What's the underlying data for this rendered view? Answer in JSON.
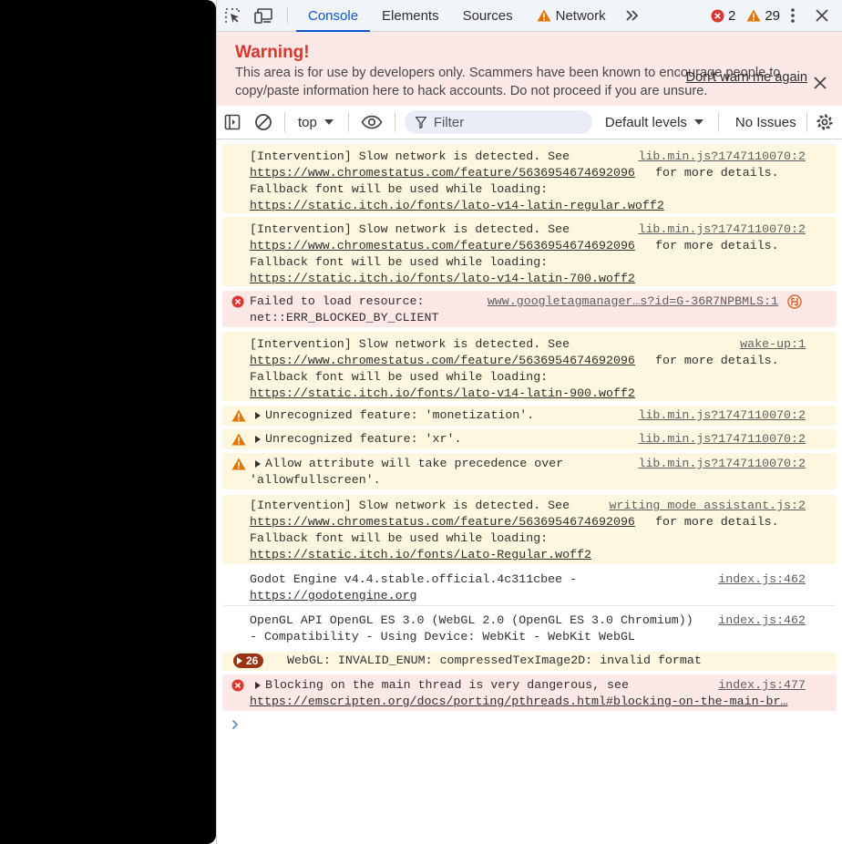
{
  "tabs": {
    "console": "Console",
    "elements": "Elements",
    "sources": "Sources",
    "network": "Network"
  },
  "counters": {
    "errors": "2",
    "warnings": "29"
  },
  "warning": {
    "title": "Warning!",
    "text": "This area is for use by developers only. Scammers have been known to encourage people to copy/paste information here to hack accounts. Do not proceed if you are unsure.",
    "dont_warn": "Don't warn me again"
  },
  "toolbar": {
    "context": "top",
    "filter_placeholder": "Filter",
    "levels": "Default levels",
    "issues": "No Issues"
  },
  "messages": [
    {
      "type": "warning",
      "lines": [
        "[Intervention] Slow network is detected. See",
        "https://www.chromestatus.com/feature/5636954674692096",
        " for more details.",
        "Fallback font will be used while loading:",
        "https://static.itch.io/fonts/lato-v14-latin-regular.woff2"
      ],
      "source": "lib.min.js?1747110070:2"
    },
    {
      "type": "warning",
      "lines": [
        "[Intervention] Slow network is detected. See",
        "https://www.chromestatus.com/feature/5636954674692096",
        " for more details.",
        "Fallback font will be used while loading:",
        "https://static.itch.io/fonts/lato-v14-latin-700.woff2"
      ],
      "source": "lib.min.js?1747110070:2"
    },
    {
      "type": "error",
      "lines": [
        "Failed to load resource:",
        "net::ERR_BLOCKED_BY_CLIENT"
      ],
      "source": "www.googletagmanager…s?id=G-36R7NPBMLS:1"
    },
    {
      "type": "warning",
      "lines": [
        "[Intervention] Slow network is detected. See",
        "https://www.chromestatus.com/feature/5636954674692096",
        " for more details.",
        "Fallback font will be used while loading:",
        "https://static.itch.io/fonts/lato-v14-latin-900.woff2"
      ],
      "source": "wake-up:1"
    },
    {
      "type": "warning",
      "lines": [
        "Unrecognized feature: 'monetization'."
      ],
      "source": "lib.min.js?1747110070:2"
    },
    {
      "type": "warning",
      "lines": [
        "Unrecognized feature: 'xr'."
      ],
      "source": "lib.min.js?1747110070:2"
    },
    {
      "type": "warning",
      "lines": [
        "Allow attribute will take precedence over",
        "'allowfullscreen'."
      ],
      "source": "lib.min.js?1747110070:2"
    },
    {
      "type": "warning",
      "lines": [
        "[Intervention] Slow network is detected. See",
        "https://www.chromestatus.com/feature/5636954674692096",
        " for more details.",
        "Fallback font will be used while loading:",
        "https://static.itch.io/fonts/Lato-Regular.woff2"
      ],
      "source": "writing_mode_assistant.js:2"
    },
    {
      "type": "info",
      "lines": [
        "Godot Engine v4.4.stable.official.4c311cbee -",
        "https://godotengine.org"
      ],
      "source": "index.js:462"
    },
    {
      "type": "info",
      "lines": [
        "OpenGL API OpenGL ES 3.0 (WebGL 2.0 (OpenGL ES 3.0 Chromium))",
        "- Compatibility - Using Device: WebKit - WebKit WebGL"
      ],
      "source": "index.js:462"
    },
    {
      "type": "warning",
      "lines": [
        "WebGL: INVALID_ENUM: compressedTexImage2D: invalid format"
      ],
      "count": "26"
    },
    {
      "type": "error",
      "lines": [
        "Blocking on the main thread is very dangerous, see",
        "https://emscripten.org/docs/porting/pthreads.html#blocking-on-the-main-br…"
      ],
      "source": "index.js:477"
    }
  ],
  "colors": {
    "accent": "#0b57d0",
    "error": "#dc362e",
    "warning": "#e37400",
    "warning_bg": "#fef7e0",
    "error_bg": "#fce8e6"
  }
}
